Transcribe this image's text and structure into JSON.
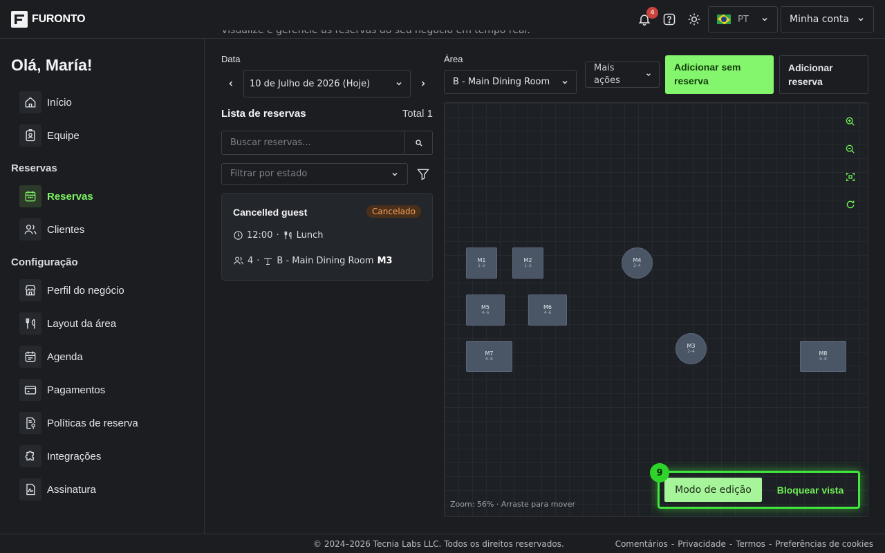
{
  "brand": {
    "name": "FURONTO"
  },
  "header": {
    "notifications_count": "4",
    "language_code": "PT",
    "account_label": "Minha conta"
  },
  "sidebar": {
    "greeting": "Olá, María!",
    "items_top": [
      {
        "label": "Início",
        "icon": "home-icon"
      },
      {
        "label": "Equipe",
        "icon": "badge-icon"
      }
    ],
    "section_reservas": "Reservas",
    "items_reservas": [
      {
        "label": "Reservas",
        "icon": "calendar-icon",
        "active": true
      },
      {
        "label": "Clientes",
        "icon": "users-icon"
      }
    ],
    "section_config": "Configuração",
    "items_config": [
      {
        "label": "Perfil do negócio",
        "icon": "store-icon"
      },
      {
        "label": "Layout da área",
        "icon": "utensils-icon"
      },
      {
        "label": "Agenda",
        "icon": "schedule-icon"
      },
      {
        "label": "Pagamentos",
        "icon": "wallet-icon"
      },
      {
        "label": "Políticas de reserva",
        "icon": "policy-icon"
      },
      {
        "label": "Integrações",
        "icon": "puzzle-icon"
      },
      {
        "label": "Assinatura",
        "icon": "signature-icon"
      }
    ]
  },
  "main": {
    "subtitle": "Visualize e gerencie as reservas do seu negócio em tempo real.",
    "date_label": "Data",
    "date_value": "10 de Julho de 2026 (Hoje)",
    "area_label": "Área",
    "area_value": "B - Main Dining Room",
    "more_actions": "Mais ações",
    "add_walkin": "Adicionar sem reserva",
    "add_reservation": "Adicionar reserva",
    "list_title": "Lista de reservas",
    "total": "Total 1",
    "search_placeholder": "Buscar reservas...",
    "filter_placeholder": "Filtrar por estado",
    "reservation": {
      "name": "Cancelled guest",
      "status": "Cancelado",
      "time": "12:00",
      "shift": "Lunch",
      "party_size": "4",
      "area": "B - Main Dining Room",
      "table": "M3"
    }
  },
  "floor": {
    "zoom_info": "Zoom: 56% · Arraste para mover",
    "tables": [
      {
        "name": "M1",
        "cap": "1–2"
      },
      {
        "name": "M2",
        "cap": "1–2"
      },
      {
        "name": "M4",
        "cap": "2–4"
      },
      {
        "name": "M5",
        "cap": "4–6"
      },
      {
        "name": "M6",
        "cap": "4–6"
      },
      {
        "name": "M3",
        "cap": "2–4"
      },
      {
        "name": "M7",
        "cap": "6–8"
      },
      {
        "name": "M8",
        "cap": "6–8"
      }
    ],
    "mode_step": "9",
    "mode_edit": "Modo de edição",
    "mode_lock": "Bloquear vista"
  },
  "footer": {
    "copyright": "© 2024–2026 Tecnia Labs LLC. Todos os direitos reservados.",
    "links": [
      "Comentários",
      "Privacidade",
      "Termos",
      "Preferências de cookies"
    ]
  },
  "colors": {
    "accent": "#84f66d",
    "status_cancel": "#f5a25a",
    "table_fill": "#4a5566"
  }
}
